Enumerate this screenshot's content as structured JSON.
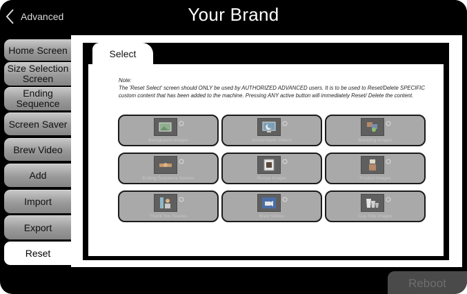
{
  "header": {
    "back_label": "Advanced",
    "brand_title": "Your Brand"
  },
  "sidebar": {
    "items": [
      {
        "label": "Home Screen"
      },
      {
        "label": "Size Selection Screen"
      },
      {
        "label": "Ending Sequence"
      },
      {
        "label": "Screen Saver"
      },
      {
        "label": "Brew Video"
      },
      {
        "label": "Add"
      },
      {
        "label": "Import"
      },
      {
        "label": "Export"
      },
      {
        "label": "Reset",
        "active": true
      }
    ]
  },
  "main": {
    "tab_label": "Select",
    "note_heading": "Note:",
    "note_body": "The 'Reset Select' screen should ONLY be used by AUTHORIZED ADVANCED users.  It is to be used to Reset/Delete SPECIFIC custom content that has been added to the machine.  Pressing ANY active button will immediately Reset/ Delete the content.",
    "tiles": [
      {
        "label": "Background Images",
        "icon": "background-image-icon"
      },
      {
        "label": "Screensaver Videos",
        "icon": "screensaver-icon"
      },
      {
        "label": "Branding Images",
        "icon": "branding-icon"
      },
      {
        "label": "Ending Sequence Scenes",
        "icon": "ending-sequence-icon"
      },
      {
        "label": "Recipe Images",
        "icon": "recipe-image-icon"
      },
      {
        "label": "Product Images",
        "icon": "product-image-icon"
      },
      {
        "label": "Thank You Scenes",
        "icon": "thank-you-icon"
      },
      {
        "label": "Brew Videos",
        "icon": "brew-video-icon"
      },
      {
        "label": "Cup Size Images",
        "icon": "cup-size-icon"
      }
    ]
  },
  "footer": {
    "reboot_label": "Reboot"
  },
  "colors": {
    "background": "#000000",
    "panel": "#ffffff",
    "tile": "#a9a9a9",
    "sidebar_tab": "#9a9a9a"
  }
}
